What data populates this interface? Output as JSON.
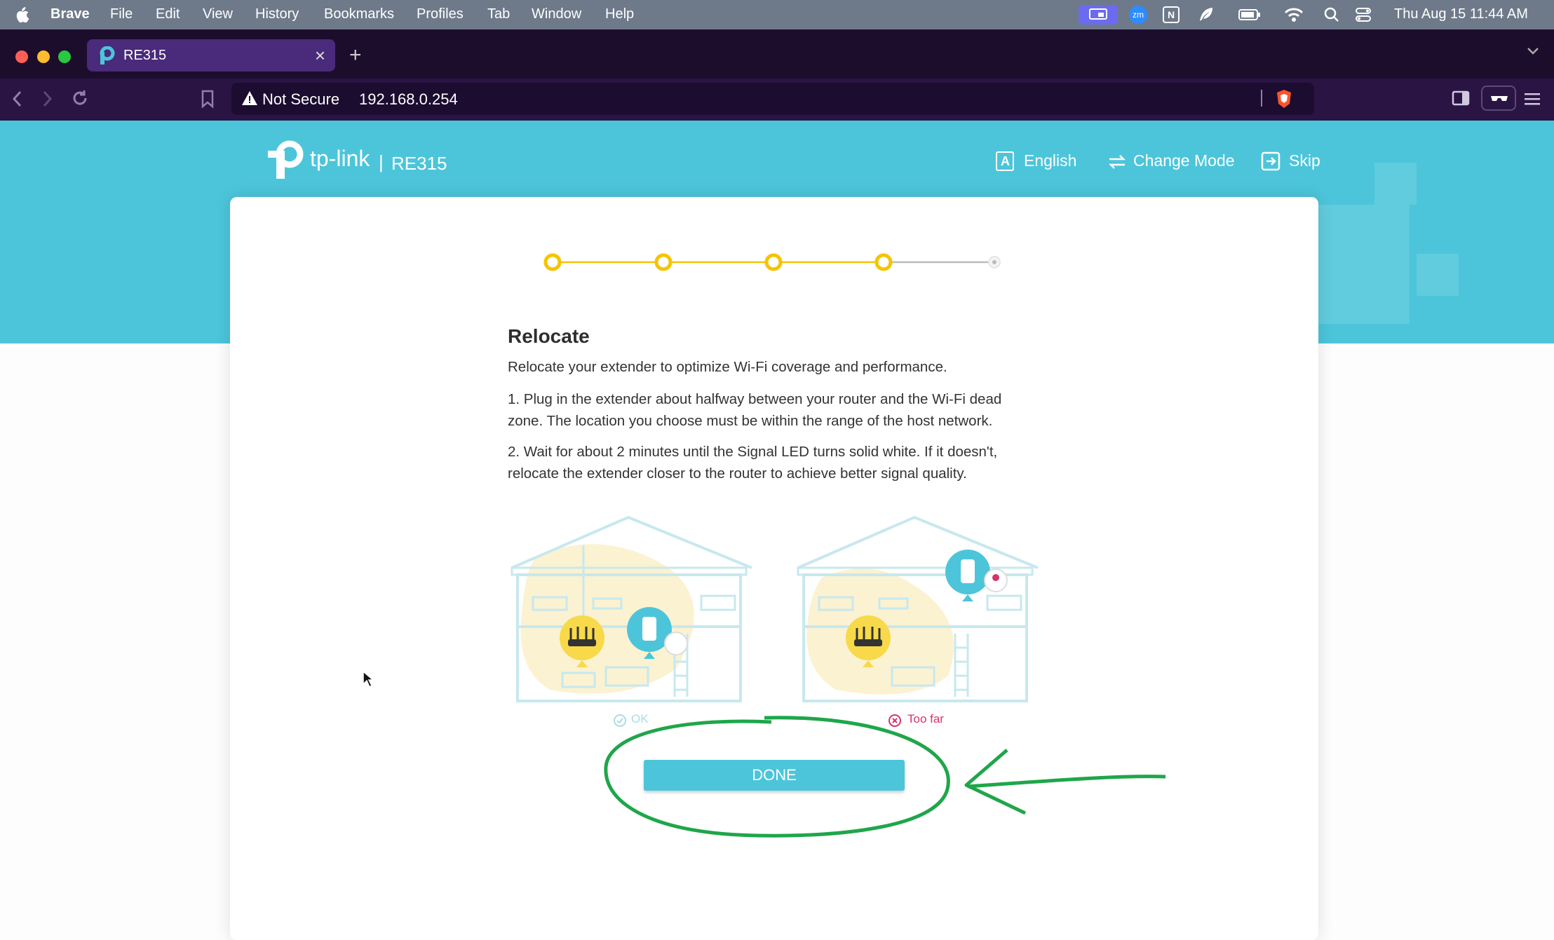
{
  "menubar": {
    "app": "Brave",
    "items": [
      "File",
      "Edit",
      "View",
      "History",
      "Bookmarks",
      "Profiles",
      "Tab",
      "Window",
      "Help"
    ],
    "tray_zoom": "zm",
    "tray_notion": "N",
    "clock": "Thu Aug 15  11:44 AM"
  },
  "browser": {
    "tab_title": "RE315",
    "new_tab": "+",
    "security": "Not Secure",
    "url": "192.168.0.254"
  },
  "header": {
    "brand": "tp-link",
    "separator": "|",
    "model": "RE315",
    "language_icon_letter": "A",
    "language": "English",
    "change_mode": "Change Mode",
    "skip": "Skip"
  },
  "progress": {
    "total_steps": 5,
    "completed_steps": 4,
    "accent": "#f5c400"
  },
  "content": {
    "title": "Relocate",
    "intro": "Relocate your extender to optimize Wi-Fi coverage and performance.",
    "step1": "1. Plug in the extender about halfway between your router and the Wi-Fi dead zone. The location you choose must be within the range of the host network.",
    "step2": "2. Wait for about 2 minutes until the Signal LED turns solid white. If it doesn't, relocate the extender closer to the router to achieve better signal quality.",
    "ok_caption": "OK",
    "toofar_caption": "Too far",
    "done_label": "DONE"
  },
  "colors": {
    "brand": "#4cc5da",
    "annotation": "#1fa64a",
    "error": "#d6336c"
  }
}
